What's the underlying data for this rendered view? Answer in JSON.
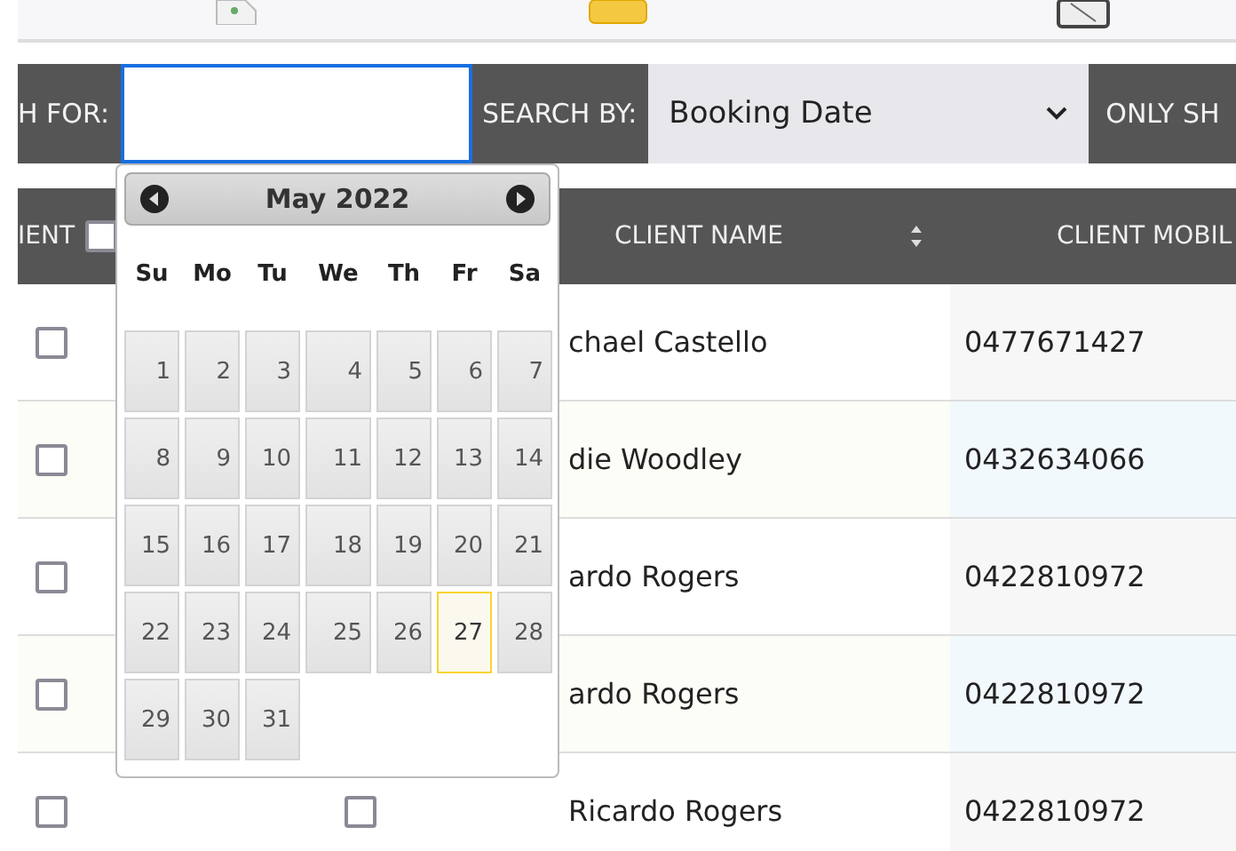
{
  "search_bar": {
    "search_for_label": "H FOR:",
    "search_for": {
      "focused": true
    },
    "search_by_label": "SEARCH BY:",
    "search_by": {
      "value": "Booking Date"
    },
    "only_show_label": "ONLY SH"
  },
  "table": {
    "columns": [
      {
        "label": "IENT",
        "kind": "checkbox-head",
        "checked": false
      },
      {
        "kind": "blank"
      },
      {
        "label": "CLIENT NAME",
        "kind": "sortable"
      },
      {
        "label": "CLIENT MOBIL",
        "kind": "plain"
      }
    ],
    "rows": [
      {
        "checked": false,
        "name": "chael Castello",
        "mobile": "0477671427"
      },
      {
        "checked": false,
        "name": "die Woodley",
        "mobile": "0432634066"
      },
      {
        "checked": false,
        "name": "ardo Rogers",
        "mobile": "0422810972"
      },
      {
        "checked": false,
        "name": "ardo Rogers",
        "mobile": "0422810972"
      },
      {
        "checked": false,
        "name": "Ricardo Rogers",
        "mobile": "0422810972",
        "second_checkbox": {
          "checked": false
        }
      }
    ]
  },
  "datepicker": {
    "title": "May 2022",
    "weekdays": [
      "Su",
      "Mo",
      "Tu",
      "We",
      "Th",
      "Fr",
      "Sa"
    ],
    "days": [
      {
        "label": "1",
        "today": false
      },
      {
        "label": "2",
        "today": false
      },
      {
        "label": "3",
        "today": false
      },
      {
        "label": "4",
        "today": false
      },
      {
        "label": "5",
        "today": false
      },
      {
        "label": "6",
        "today": false
      },
      {
        "label": "7",
        "today": false
      },
      {
        "label": "8",
        "today": false
      },
      {
        "label": "9",
        "today": false
      },
      {
        "label": "10",
        "today": false
      },
      {
        "label": "11",
        "today": false
      },
      {
        "label": "12",
        "today": false
      },
      {
        "label": "13",
        "today": false
      },
      {
        "label": "14",
        "today": false
      },
      {
        "label": "15",
        "today": false
      },
      {
        "label": "16",
        "today": false
      },
      {
        "label": "17",
        "today": false
      },
      {
        "label": "18",
        "today": false
      },
      {
        "label": "19",
        "today": false
      },
      {
        "label": "20",
        "today": false
      },
      {
        "label": "21",
        "today": false
      },
      {
        "label": "22",
        "today": false
      },
      {
        "label": "23",
        "today": false
      },
      {
        "label": "24",
        "today": false
      },
      {
        "label": "25",
        "today": false
      },
      {
        "label": "26",
        "today": false
      },
      {
        "label": "27",
        "today": true
      },
      {
        "label": "28",
        "today": false
      },
      {
        "label": "29",
        "today": false
      },
      {
        "label": "30",
        "today": false
      },
      {
        "label": "31",
        "today": false
      }
    ]
  }
}
